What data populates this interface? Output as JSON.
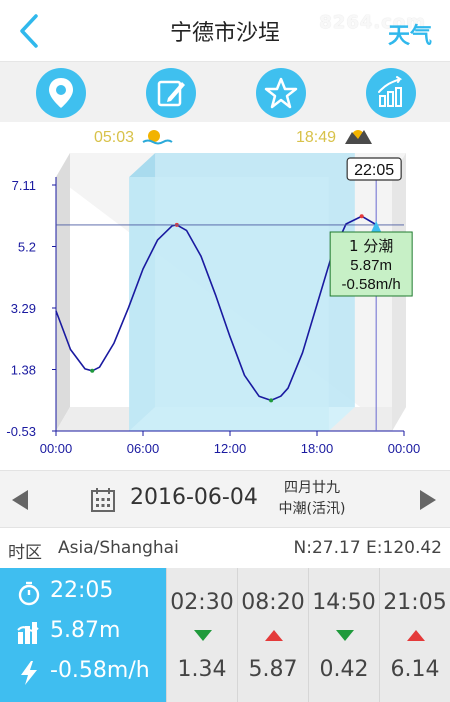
{
  "header": {
    "title": "宁德市沙埕",
    "weather_label": "天气",
    "watermark": "8264.com"
  },
  "toolbar": {
    "items": [
      {
        "name": "location",
        "icon": "location-pin-icon"
      },
      {
        "name": "edit",
        "icon": "edit-icon"
      },
      {
        "name": "favorite",
        "icon": "star-icon"
      },
      {
        "name": "stats",
        "icon": "bar-chart-icon"
      }
    ]
  },
  "chart_data": {
    "type": "line",
    "sunrise": "05:03",
    "sunset": "18:49",
    "x_ticks": [
      "00:00",
      "06:00",
      "12:00",
      "18:00",
      "00:00"
    ],
    "y_ticks": [
      "7.11",
      "5.2",
      "3.29",
      "1.38",
      "-0.53"
    ],
    "ylim": [
      -0.53,
      7.11
    ],
    "xlim_hours": [
      0,
      24
    ],
    "series": [
      {
        "x_hours": [
          0,
          1,
          2,
          2.5,
          3,
          4,
          5,
          6,
          7,
          8,
          8.33,
          9,
          10,
          11,
          12,
          13,
          14,
          14.83,
          15.5,
          16,
          17,
          18,
          19,
          20,
          21,
          21.08,
          22
        ],
        "values": [
          3.2,
          2.0,
          1.4,
          1.34,
          1.45,
          2.2,
          3.3,
          4.5,
          5.4,
          5.84,
          5.87,
          5.7,
          4.9,
          3.7,
          2.4,
          1.2,
          0.55,
          0.42,
          0.55,
          0.8,
          1.9,
          3.4,
          4.9,
          5.9,
          6.12,
          6.14,
          5.9
        ]
      }
    ],
    "cursor": {
      "time": "22:05",
      "hour": 22.08,
      "label": "1 分潮",
      "height": "5.87m",
      "rate": "-0.58m/h",
      "level": 5.87
    }
  },
  "datebar": {
    "date": "2016-06-04",
    "lunar_date": "四月廿九",
    "tide_type": "中潮(活汛)"
  },
  "info": {
    "tz_label": "时区",
    "tz_value": "Asia/Shanghai",
    "coords": "N:27.17  E:120.42"
  },
  "current": {
    "time": "22:05",
    "height": "5.87m",
    "rate": "-0.58m/h"
  },
  "tides": [
    {
      "time": "02:30",
      "dir": "down",
      "height": "1.34"
    },
    {
      "time": "08:20",
      "dir": "up",
      "height": "5.87"
    },
    {
      "time": "14:50",
      "dir": "down",
      "height": "0.42"
    },
    {
      "time": "21:05",
      "dir": "up",
      "height": "6.14"
    }
  ],
  "colors": {
    "accent": "#3fbef0",
    "curve": "#1a1aa0",
    "low_marker": "#1f9a3c",
    "high_marker": "#e43a3a",
    "daylight": "#c9ecf7"
  }
}
